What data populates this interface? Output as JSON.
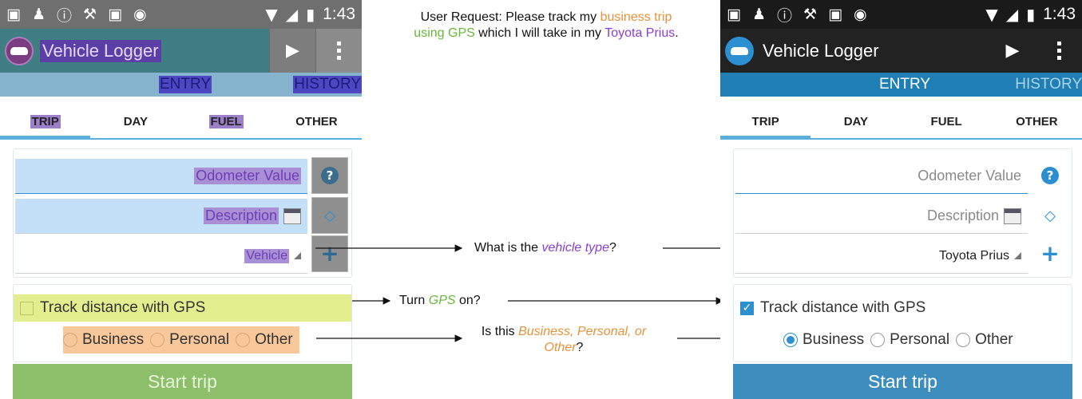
{
  "request": {
    "prefix": "User Request: Please track my ",
    "highlight_business": "business trip",
    "highlight_gps": "using GPS",
    "middle": " which I will take in my ",
    "highlight_vehicle": "Toyota Prius",
    "suffix": "."
  },
  "questions": {
    "vehicle_prefix": "What is the ",
    "vehicle_em": "vehicle type",
    "vehicle_suffix": "?",
    "gps_prefix": "Turn ",
    "gps_em": "GPS",
    "gps_suffix": " on?",
    "purpose_prefix": "Is this ",
    "purpose_em": "Business, Personal, or Other",
    "purpose_suffix": "?"
  },
  "left_screen": {
    "status": {
      "time": "1:43"
    },
    "app_title": "Vehicle Logger",
    "nav": {
      "entry": "ENTRY",
      "history": "HISTORY"
    },
    "tabs": [
      "TRIP",
      "DAY",
      "FUEL",
      "OTHER"
    ],
    "fields": {
      "odometer_placeholder": "Odometer Value",
      "description_placeholder": "Description",
      "vehicle_value": "Vehicle"
    },
    "gps_label": "Track distance with GPS",
    "purpose_options": [
      "Business",
      "Personal",
      "Other"
    ],
    "start_button": "Start trip"
  },
  "right_screen": {
    "status": {
      "time": "1:43"
    },
    "app_title": "Vehicle Logger",
    "nav": {
      "entry": "ENTRY",
      "history": "HISTORY"
    },
    "tabs": [
      "TRIP",
      "DAY",
      "FUEL",
      "OTHER"
    ],
    "fields": {
      "odometer_placeholder": "Odometer Value",
      "description_placeholder": "Description",
      "vehicle_value": "Toyota Prius"
    },
    "gps_label": "Track distance with GPS",
    "purpose_options": [
      "Business",
      "Personal",
      "Other"
    ],
    "selected_purpose": "Business",
    "gps_checked": true,
    "start_button": "Start trip"
  },
  "colors": {
    "accent_blue": "#2b8fd0",
    "highlight_orange": "#e6923a",
    "highlight_green": "#69b53d",
    "highlight_purple": "#8a3fd0"
  }
}
